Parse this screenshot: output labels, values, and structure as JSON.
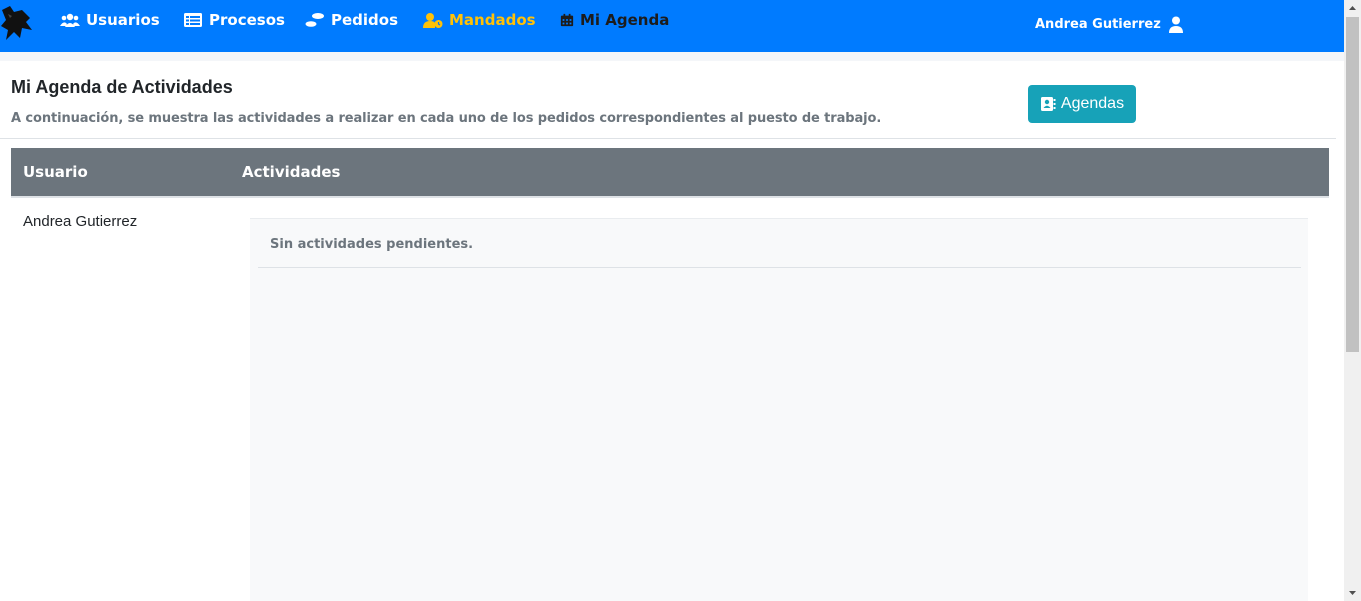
{
  "nav": {
    "items": [
      {
        "label": "Usuarios",
        "icon": "users-icon"
      },
      {
        "label": "Procesos",
        "icon": "list-icon"
      },
      {
        "label": "Pedidos",
        "icon": "shoe-prints-icon"
      },
      {
        "label": "Mandados",
        "icon": "user-clock-icon"
      },
      {
        "label": "Mi Agenda",
        "icon": "calendar-icon"
      }
    ],
    "active_color": "#ffc107",
    "user_name": "Andrea Gutierrez"
  },
  "page": {
    "title": "Mi Agenda de Actividades",
    "description": "A continuación, se muestra las actividades a realizar en cada uno de los pedidos correspondientes al puesto de trabajo.",
    "agendas_button": "Agendas"
  },
  "table": {
    "headers": [
      "Usuario",
      "Actividades"
    ],
    "rows": [
      {
        "usuario": "Andrea Gutierrez",
        "actividades": "Sin actividades pendientes."
      }
    ]
  },
  "colors": {
    "navbar": "#007bff",
    "table_header": "#6c757d",
    "button": "#17a2b8"
  }
}
